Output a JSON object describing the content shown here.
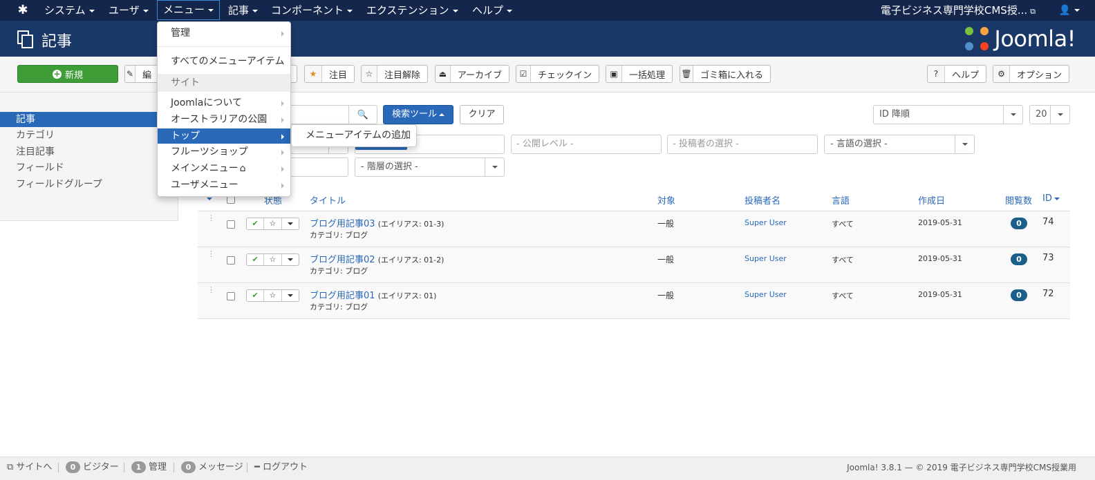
{
  "nav": {
    "items": [
      {
        "label": "システム"
      },
      {
        "label": "ユーザ"
      },
      {
        "label": "メニュー"
      },
      {
        "label": "記事"
      },
      {
        "label": "コンポーネント"
      },
      {
        "label": "エクステンション"
      },
      {
        "label": "ヘルプ"
      }
    ],
    "site_name": "電子ビジネス専門学校CMS授...",
    "logo_icon": "joomla-icon",
    "user_icon": "user-icon"
  },
  "header": {
    "title": "記事",
    "logo_text": "Joomla!"
  },
  "toolbar": {
    "new_label": "新規",
    "edit_label": "編",
    "feature_label": "注目",
    "unfeature_label": "注目解除",
    "archive_label": "アーカイブ",
    "checkin_label": "チェックイン",
    "batch_label": "一括処理",
    "trash_label": "ゴミ箱に入れる",
    "help_label": "ヘルプ",
    "options_label": "オプション"
  },
  "sidebar": {
    "items": [
      {
        "label": "記事"
      },
      {
        "label": "カテゴリ"
      },
      {
        "label": "注目記事"
      },
      {
        "label": "フィールド"
      },
      {
        "label": "フィールドグループ"
      }
    ]
  },
  "filters": {
    "search_tools_label": "検索ツール",
    "clear_label": "クリア",
    "ordering_value": "ID 降順",
    "limit_value": "20",
    "access_placeholder": "- 公開レベル -",
    "author_placeholder": "- 投稿者の選択 -",
    "language_value": "- 言語の選択 -",
    "level_value": "- 階層の選択 -"
  },
  "table": {
    "headers": {
      "status": "状態",
      "title": "タイトル",
      "access": "対象",
      "author": "投稿者名",
      "language": "言語",
      "created": "作成日",
      "hits": "閲覧数",
      "id": "ID"
    },
    "rows": [
      {
        "title": "ブログ用記事03",
        "alias": "(エイリアス: 01-3)",
        "category": "カテゴリ: ブログ",
        "access": "一般",
        "author": "Super User",
        "language": "すべて",
        "created": "2019-05-31",
        "hits": "0",
        "id": "74"
      },
      {
        "title": "ブログ用記事02",
        "alias": "(エイリアス: 01-2)",
        "category": "カテゴリ: ブログ",
        "access": "一般",
        "author": "Super User",
        "language": "すべて",
        "created": "2019-05-31",
        "hits": "0",
        "id": "73"
      },
      {
        "title": "ブログ用記事01",
        "alias": "(エイリアス: 01)",
        "category": "カテゴリ: ブログ",
        "access": "一般",
        "author": "Super User",
        "language": "すべて",
        "created": "2019-05-31",
        "hits": "0",
        "id": "72"
      }
    ]
  },
  "menu_dropdown": {
    "manage": "管理",
    "all_items": "すべてのメニューアイテム",
    "site_header": "サイト",
    "menus": [
      {
        "label": "Joomlaについて"
      },
      {
        "label": "オーストラリアの公園"
      },
      {
        "label": "トップ"
      },
      {
        "label": "フルーツショップ"
      },
      {
        "label": "メインメニュー"
      },
      {
        "label": "ユーザメニュー"
      }
    ],
    "submenu_add": "メニューアイテムの追加"
  },
  "footer": {
    "view_site": "サイトへ",
    "visitors_count": "0",
    "visitors_label": "ビジター",
    "admins_count": "1",
    "admins_label": "管理",
    "messages_count": "0",
    "messages_label": "メッセージ",
    "logout": "ログアウト",
    "copyright": "Joomla! 3.8.1 — © 2019 電子ビジネス専門学校CMS授業用"
  },
  "colors": {
    "nav_bg": "#14264b",
    "header_bg": "#1a3867",
    "accent": "#2a69b8",
    "new_button": "#3f9d38"
  }
}
